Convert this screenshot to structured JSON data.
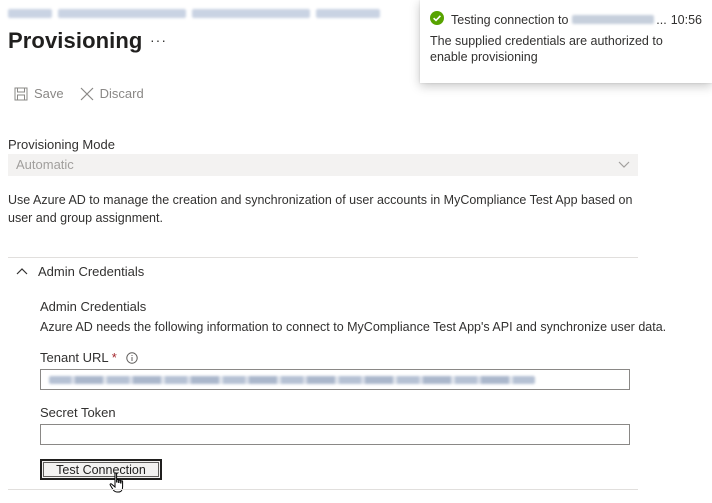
{
  "breadcrumb": {
    "blurred_segments": 4
  },
  "page": {
    "title": "Provisioning",
    "more_label": "···"
  },
  "toolbar": {
    "save_label": "Save",
    "discard_label": "Discard",
    "save_icon": "save-icon",
    "discard_icon": "close-icon"
  },
  "provisioning_mode": {
    "label": "Provisioning Mode",
    "selected_value": "Automatic",
    "description": "Use Azure AD to manage the creation and synchronization of user accounts in MyCompliance Test App based on user and group assignment."
  },
  "admin_credentials": {
    "section_label": "Admin Credentials",
    "title": "Admin Credentials",
    "description": "Azure AD needs the following information to connect to MyCompliance Test App's API and synchronize user data.",
    "tenant_url": {
      "label": "Tenant URL",
      "required_mark": "*",
      "value_redacted": true
    },
    "secret_token": {
      "label": "Secret Token",
      "value": ""
    },
    "test_button_label": "Test Connection"
  },
  "notification": {
    "title_prefix": "Testing connection to",
    "title_suffix": "...",
    "time": "10:56",
    "message": "The supplied credentials are authorized to enable provisioning",
    "status_color": "#57a300"
  },
  "colors": {
    "accent_text": "#323130",
    "disabled_text": "#8a8886",
    "required": "#a4262c",
    "success": "#57a300"
  }
}
